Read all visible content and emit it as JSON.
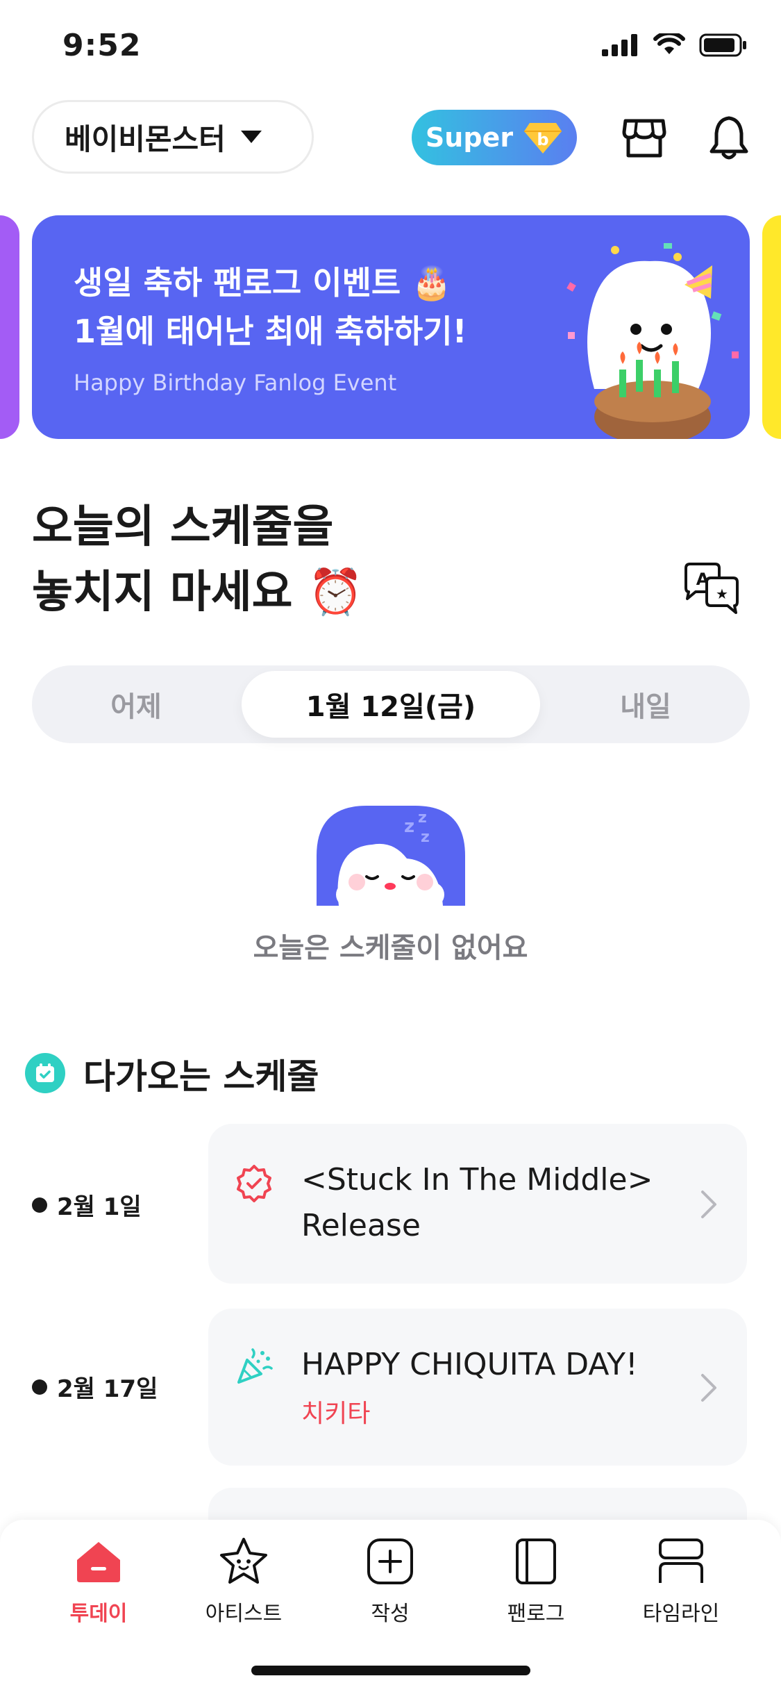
{
  "status_bar": {
    "time": "9:52"
  },
  "header": {
    "group_name": "베이비몬스터",
    "super_label": "Super",
    "super_badge": "b",
    "icons": [
      "shop-icon",
      "bell-icon"
    ]
  },
  "banner": {
    "title_line1": "생일 축하 팬로그 이벤트 🎂",
    "title_line2": "1월에 태어난 최애 축하하기!",
    "subtitle": "Happy Birthday Fanlog Event",
    "bg_color": "#5865f2"
  },
  "today": {
    "title_line1": "오늘의 스케줄을",
    "title_line2": "놓치지 마세요 ⏰",
    "tabs": [
      {
        "label": "어제",
        "active": false
      },
      {
        "label": "1월 12일(금)",
        "active": true
      },
      {
        "label": "내일",
        "active": false
      }
    ],
    "empty_text": "오늘은 스케줄이 없어요"
  },
  "upcoming": {
    "title": "다가오는 스케줄",
    "items": [
      {
        "date": "2월 1일",
        "title_line1": "<Stuck In The Middle>",
        "title_line2": "Release",
        "subtitle": "",
        "icon": "release-badge-icon"
      },
      {
        "date": "2월 17일",
        "title_line1": "HAPPY CHIQUITA DAY!",
        "title_line2": "",
        "subtitle": "치키타",
        "icon": "party-popper-icon"
      }
    ]
  },
  "bottom_nav": {
    "items": [
      {
        "label": "투데이",
        "icon": "home-icon",
        "active": true
      },
      {
        "label": "아티스트",
        "icon": "star-face-icon",
        "active": false
      },
      {
        "label": "작성",
        "icon": "plus-square-icon",
        "active": false
      },
      {
        "label": "팬로그",
        "icon": "book-icon",
        "active": false
      },
      {
        "label": "타임라인",
        "icon": "timeline-icon",
        "active": false
      }
    ]
  },
  "colors": {
    "accent_red": "#f04452",
    "teal": "#2fd0c3",
    "banner_blue": "#5865f2"
  }
}
